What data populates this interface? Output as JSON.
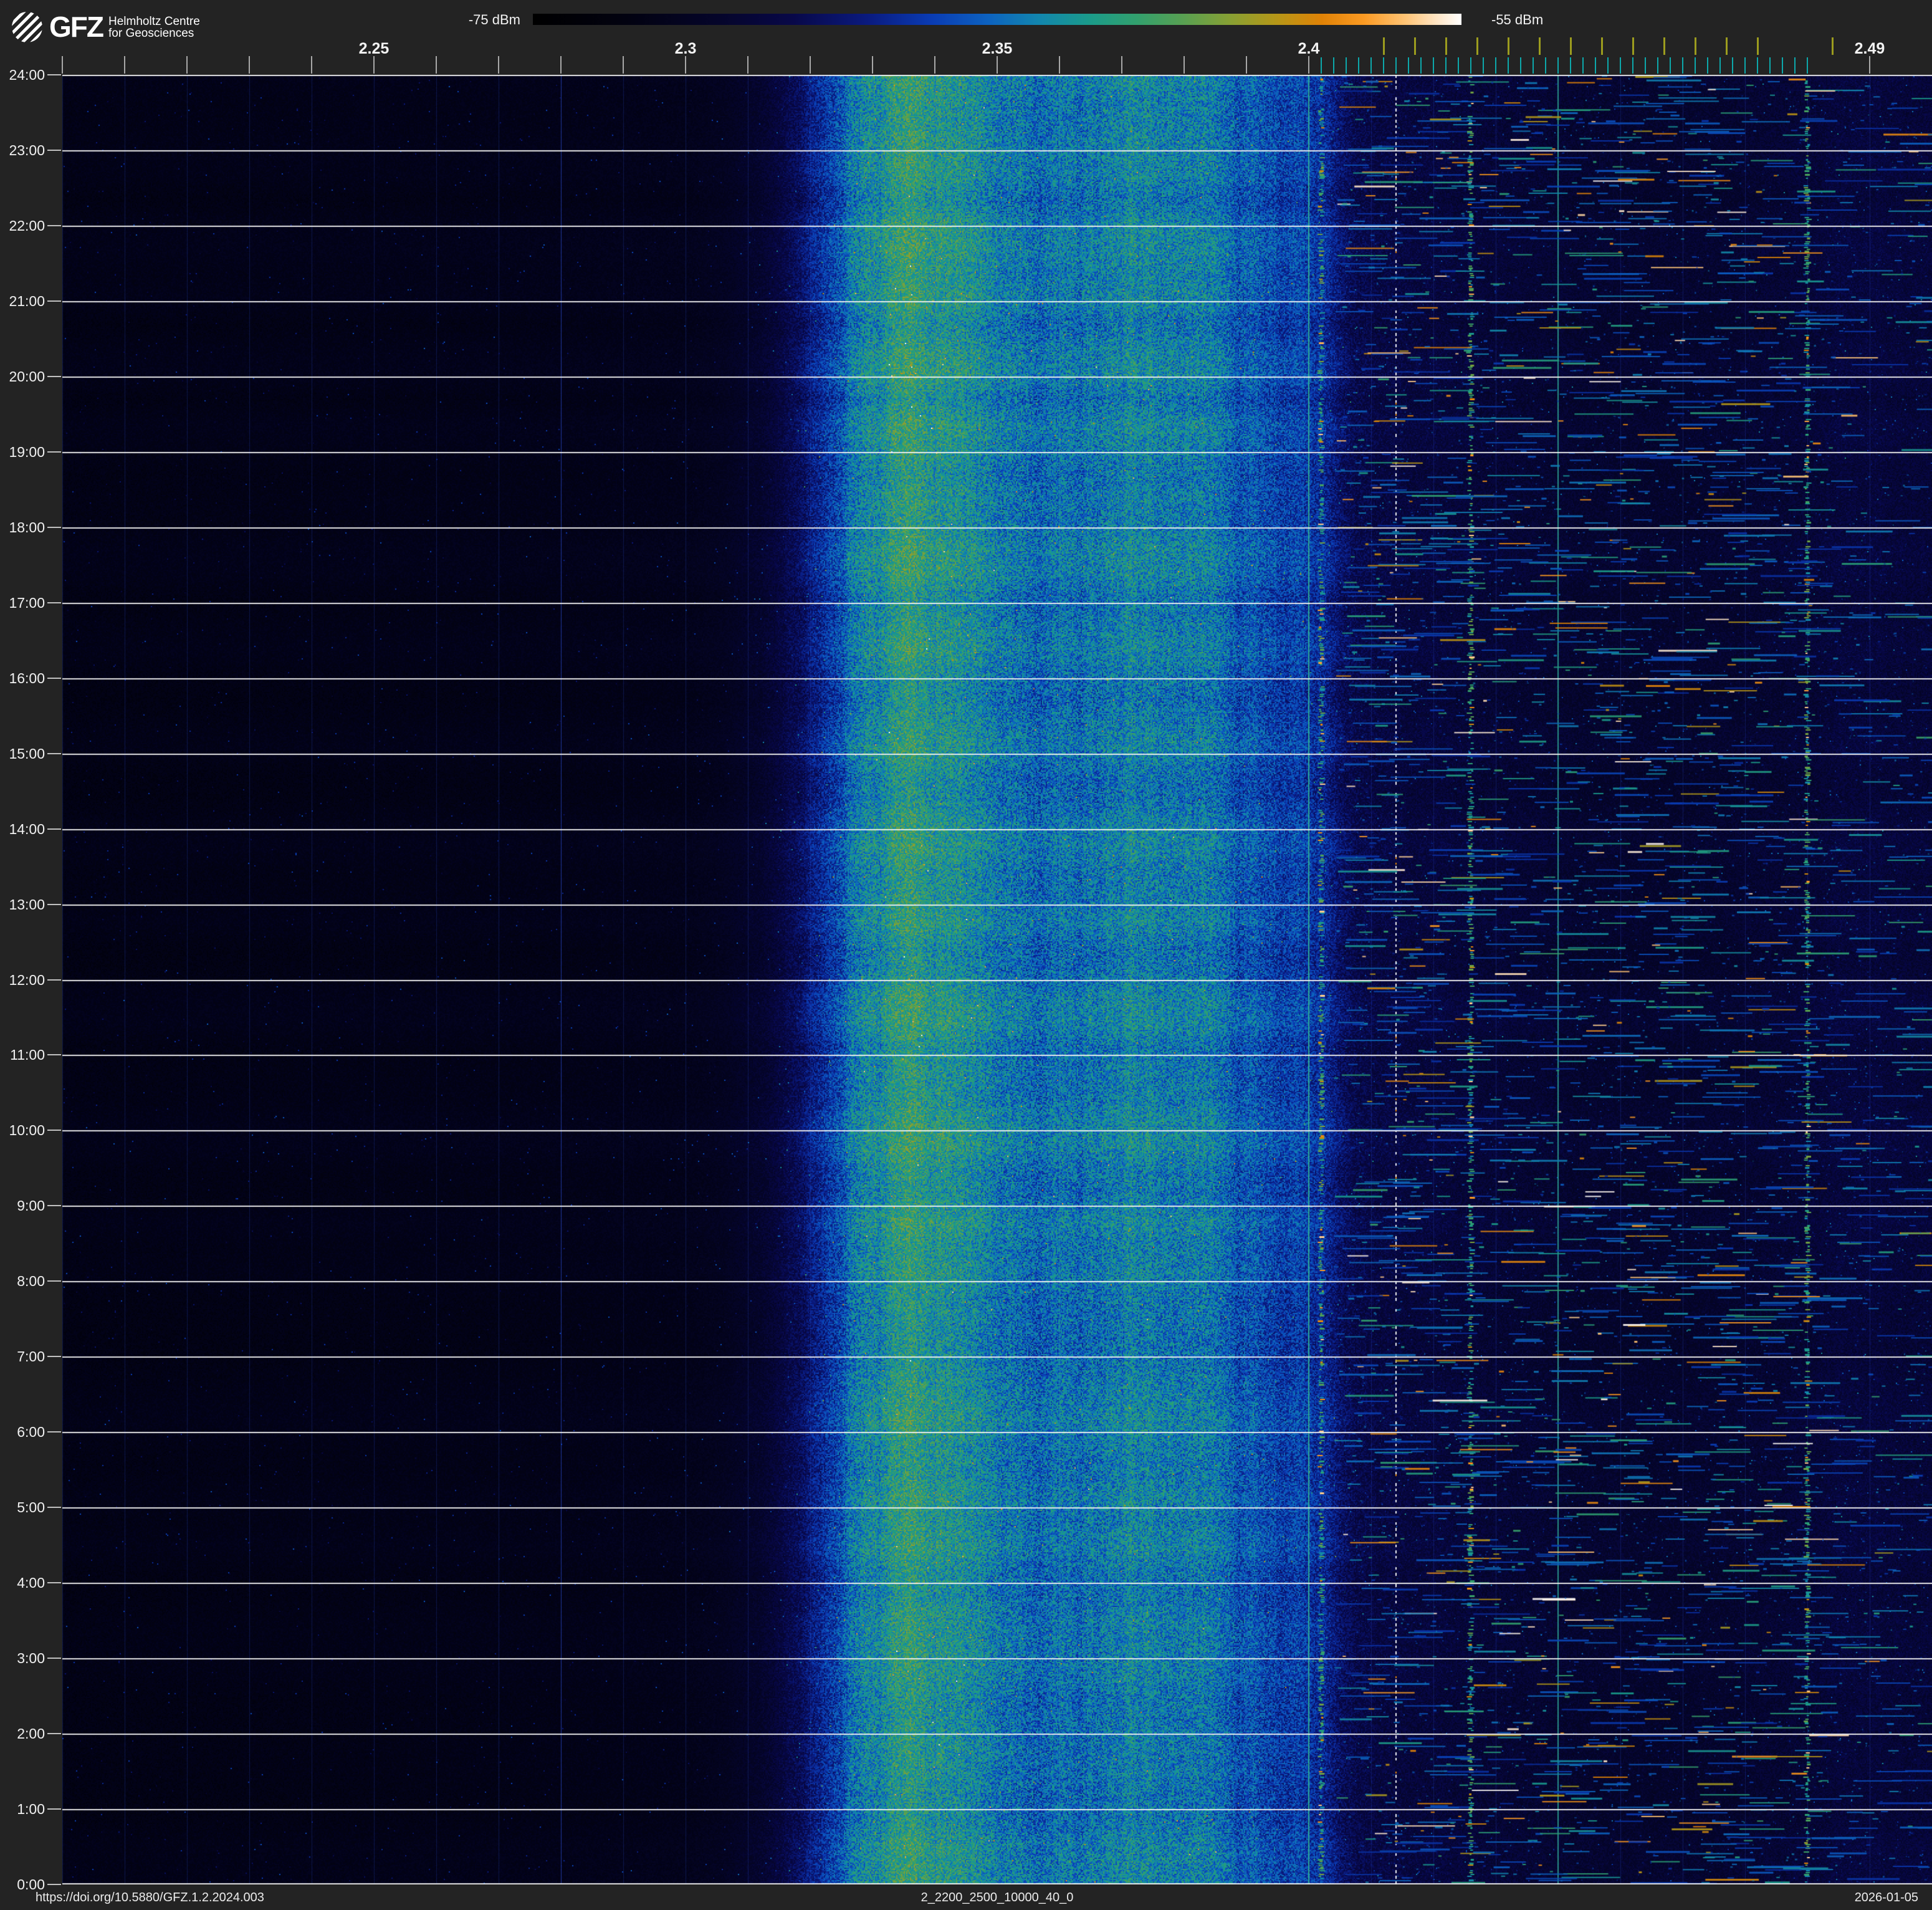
{
  "header": {
    "logo": {
      "brand": "GFZ",
      "org_line1": "Helmholtz Centre",
      "org_line2": "for Geosciences"
    },
    "colorbar": {
      "min_label": "-75 dBm",
      "max_label": "-55 dBm"
    }
  },
  "footer": {
    "doi": "https://doi.org/10.5880/GFZ.1.2.2024.003",
    "dataset_id": "2_2200_2500_10000_40_0",
    "date": "2026-01-05"
  },
  "chart_data": {
    "type": "heatmap",
    "subtype": "rf-spectrogram-waterfall",
    "x_axis": {
      "unit": "GHz",
      "min": 2.2,
      "max": 2.5,
      "major_labels": [
        {
          "text": "2.25",
          "ghz": 2.25
        },
        {
          "text": "2.3",
          "ghz": 2.3
        },
        {
          "text": "2.35",
          "ghz": 2.35
        },
        {
          "text": "2.4",
          "ghz": 2.4
        },
        {
          "text": "2.49",
          "ghz": 2.49
        }
      ],
      "gray_ticks": {
        "start_ghz": 2.2,
        "step_ghz": 0.01,
        "count": 21,
        "extra_ghz": [
          2.49
        ]
      },
      "wifi_channel_ticks": {
        "start_ghz": 2.412,
        "step_ghz": 0.005,
        "count": 13,
        "extra_ghz": [
          2.484
        ],
        "color": "#9c9c1e"
      },
      "ble_channel_ticks": {
        "start_ghz": 2.402,
        "step_ghz": 0.002,
        "count": 40,
        "color": "#0da8ab"
      }
    },
    "y_axis": {
      "unit": "time of day",
      "top_to_bottom": true,
      "labels": [
        "24:00",
        "23:00",
        "22:00",
        "21:00",
        "20:00",
        "19:00",
        "18:00",
        "17:00",
        "16:00",
        "15:00",
        "14:00",
        "13:00",
        "12:00",
        "11:00",
        "10:00",
        "9:00",
        "8:00",
        "7:00",
        "6:00",
        "5:00",
        "4:00",
        "3:00",
        "2:00",
        "1:00",
        "0:00"
      ]
    },
    "colorbar_range_dbm": {
      "min": -75,
      "max": -55
    },
    "colormap": [
      {
        "t": 0.0,
        "c": "#000000"
      },
      {
        "t": 0.1,
        "c": "#020210"
      },
      {
        "t": 0.2,
        "c": "#05052a"
      },
      {
        "t": 0.28,
        "c": "#080848"
      },
      {
        "t": 0.36,
        "c": "#0a1a7e"
      },
      {
        "t": 0.43,
        "c": "#0a3cb4"
      },
      {
        "t": 0.49,
        "c": "#0d62c0"
      },
      {
        "t": 0.545,
        "c": "#1286ae"
      },
      {
        "t": 0.6,
        "c": "#1b9b8a"
      },
      {
        "t": 0.65,
        "c": "#32a06e"
      },
      {
        "t": 0.7,
        "c": "#58a052"
      },
      {
        "t": 0.75,
        "c": "#87a034"
      },
      {
        "t": 0.8,
        "c": "#b59718"
      },
      {
        "t": 0.85,
        "c": "#e08206"
      },
      {
        "t": 0.895,
        "c": "#fb9a23"
      },
      {
        "t": 0.94,
        "c": "#ffc476"
      },
      {
        "t": 0.97,
        "c": "#ffe2bd"
      },
      {
        "t": 1.0,
        "c": "#ffffff"
      }
    ],
    "intensity_profile_ghz_t": [
      [
        2.2,
        0.125
      ],
      [
        2.24,
        0.13
      ],
      [
        2.28,
        0.135
      ],
      [
        2.3,
        0.145
      ],
      [
        2.306,
        0.165
      ],
      [
        2.312,
        0.21
      ],
      [
        2.318,
        0.3
      ],
      [
        2.323,
        0.42
      ],
      [
        2.328,
        0.54
      ],
      [
        2.332,
        0.6
      ],
      [
        2.336,
        0.625
      ],
      [
        2.341,
        0.615
      ],
      [
        2.346,
        0.585
      ],
      [
        2.351,
        0.545
      ],
      [
        2.356,
        0.51
      ],
      [
        2.36,
        0.5
      ],
      [
        2.364,
        0.525
      ],
      [
        2.369,
        0.55
      ],
      [
        2.374,
        0.555
      ],
      [
        2.379,
        0.545
      ],
      [
        2.384,
        0.515
      ],
      [
        2.389,
        0.48
      ],
      [
        2.394,
        0.455
      ],
      [
        2.399,
        0.43
      ],
      [
        2.402,
        0.4
      ],
      [
        2.4045,
        0.34
      ],
      [
        2.407,
        0.295
      ],
      [
        2.41,
        0.27
      ],
      [
        2.414,
        0.255
      ],
      [
        2.42,
        0.25
      ],
      [
        2.428,
        0.24
      ],
      [
        2.436,
        0.225
      ],
      [
        2.444,
        0.215
      ],
      [
        2.452,
        0.21
      ],
      [
        2.46,
        0.21
      ],
      [
        2.468,
        0.215
      ],
      [
        2.474,
        0.225
      ],
      [
        2.48,
        0.235
      ],
      [
        2.486,
        0.25
      ],
      [
        2.493,
        0.245
      ],
      [
        2.5,
        0.24
      ]
    ],
    "grid": {
      "hour_line_color": "#f2f2f2",
      "v_minor_color": "rgba(45,85,225,0.25)",
      "v_strong": [
        {
          "ghz": 2.28,
          "color": "rgba(50,90,235,0.5)"
        }
      ]
    },
    "persistent_carriers": [
      {
        "ghz": 2.36,
        "style": "solid",
        "color": "#2fae96",
        "alpha": 0.5,
        "width": 1
      },
      {
        "ghz": 2.4,
        "style": "solid",
        "color": "#2fae96",
        "alpha": 0.95,
        "width": 2
      },
      {
        "ghz": 2.44,
        "style": "solid",
        "color": "#2fae96",
        "alpha": 0.8,
        "width": 2
      },
      {
        "ghz": 2.414,
        "style": "dashed-white",
        "color": "#eef0f4",
        "alpha": 0.95,
        "width": 2
      }
    ],
    "ble_advertising_columns_ghz": [
      2.402,
      2.426,
      2.48
    ],
    "impulsive_noise_zones": [
      {
        "ghz": [
          2.404,
          2.4805
        ],
        "dashes": 3200,
        "dots": 2600,
        "bright_ratio": 0.1
      },
      {
        "ghz": [
          2.4805,
          2.4995
        ],
        "dashes": 420,
        "dots": 750,
        "bright_ratio": 0.02
      }
    ]
  }
}
